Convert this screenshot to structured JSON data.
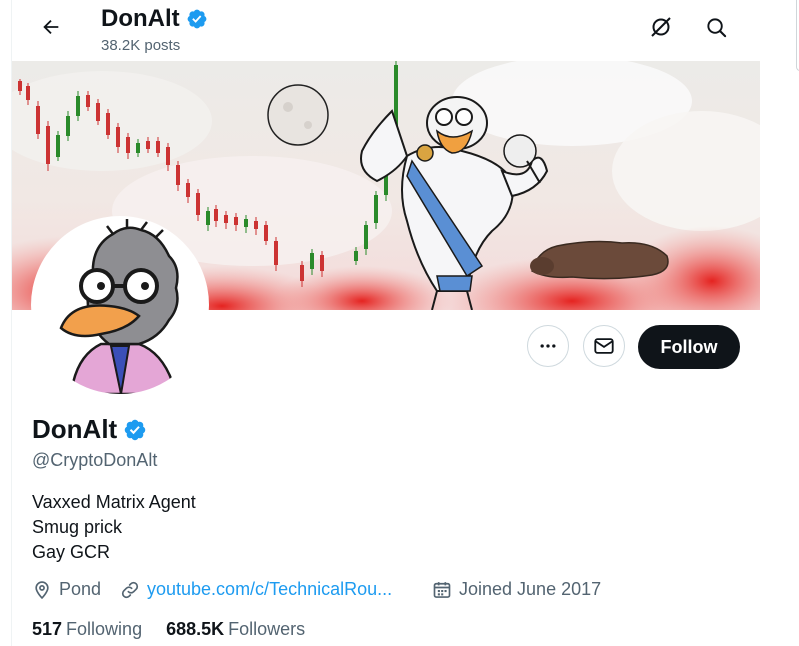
{
  "header": {
    "name": "DonAlt",
    "posts": "38.2K posts",
    "icons": [
      "back-arrow-icon",
      "grok-icon",
      "search-icon"
    ]
  },
  "profile": {
    "name": "DonAlt",
    "handle": "@CryptoDonAlt",
    "bio": [
      "Vaxxed Matrix Agent",
      "Smug prick",
      "Gay GCR"
    ],
    "location": "Pond",
    "link": "youtube.com/c/TechnicalRou...",
    "joined": "Joined June 2017",
    "following_count": "517",
    "following_label": "Following",
    "followers_count": "688.5K",
    "followers_label": "Followers"
  },
  "actions": {
    "follow_label": "Follow",
    "more_icon": "more-dots-icon",
    "message_icon": "envelope-icon"
  },
  "colors": {
    "accent": "#1d9bf0",
    "text_primary": "#0f1419",
    "text_secondary": "#536471",
    "follow_bg": "#0f1419"
  }
}
